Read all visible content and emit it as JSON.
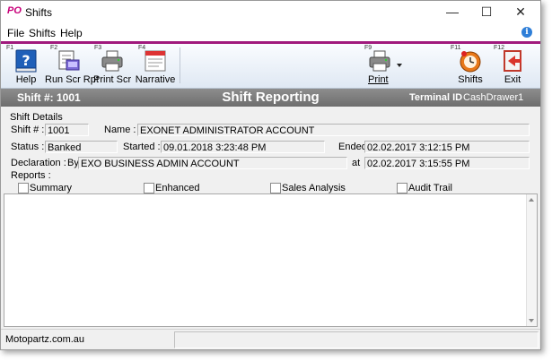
{
  "window": {
    "logo": "PO",
    "title": "Shifts",
    "minimize": "—",
    "maximize": "☐",
    "close": "✕"
  },
  "menu": {
    "file": "File",
    "shifts": "Shifts",
    "help": "Help",
    "info_icon": "i"
  },
  "toolbar": {
    "help": {
      "key": "F1",
      "label": "Help"
    },
    "run_scr_rpt": {
      "key": "F2",
      "label": "Run Scr Rpt"
    },
    "print_scr": {
      "key": "F3",
      "label": "Print Scr"
    },
    "narrative": {
      "key": "F4",
      "label": "Narrative"
    },
    "print": {
      "key": "F9",
      "label": "Print"
    },
    "shifts": {
      "key": "F11",
      "label": "Shifts"
    },
    "exit": {
      "key": "F12",
      "label": "Exit"
    }
  },
  "banner": {
    "shift_label": "Shift #: 1001",
    "heading": "Shift Reporting",
    "terminal_label": "Terminal ID",
    "terminal_value": "CashDrawer1"
  },
  "details": {
    "group_label": "Shift Details",
    "shift_label": "Shift # :",
    "shift_value": "1001",
    "name_label": "Name :",
    "name_value": "EXONET ADMINISTRATOR ACCOUNT",
    "status_label": "Status :",
    "status_value": "Banked",
    "started_label": "Started :",
    "started_value": "09.01.2018 3:23:48 PM",
    "ended_label": "Ended",
    "ended_value": "02.02.2017 3:12:15 PM",
    "declaration_label": "Declaration :",
    "by_label": "By",
    "by_value": "EXO BUSINESS ADMIN ACCOUNT",
    "at_label": "at",
    "at_value": "02.02.2017 3:15:55 PM"
  },
  "reports": {
    "label": "Reports :",
    "summary": "Summary",
    "enhanced": "Enhanced",
    "sales_analysis": "Sales Analysis",
    "audit_trail": "Audit Trail"
  },
  "status": {
    "text": "Motopartz.com.au"
  },
  "icons": {
    "help": "help-book-icon",
    "run": "report-icon",
    "print": "printer-icon",
    "narrative": "narrative-icon",
    "shifts": "clock-icon",
    "exit": "exit-icon"
  },
  "colors": {
    "accent": "#a0197d",
    "banner": "#7a7a7a",
    "help_blue": "#2f6fc8"
  }
}
